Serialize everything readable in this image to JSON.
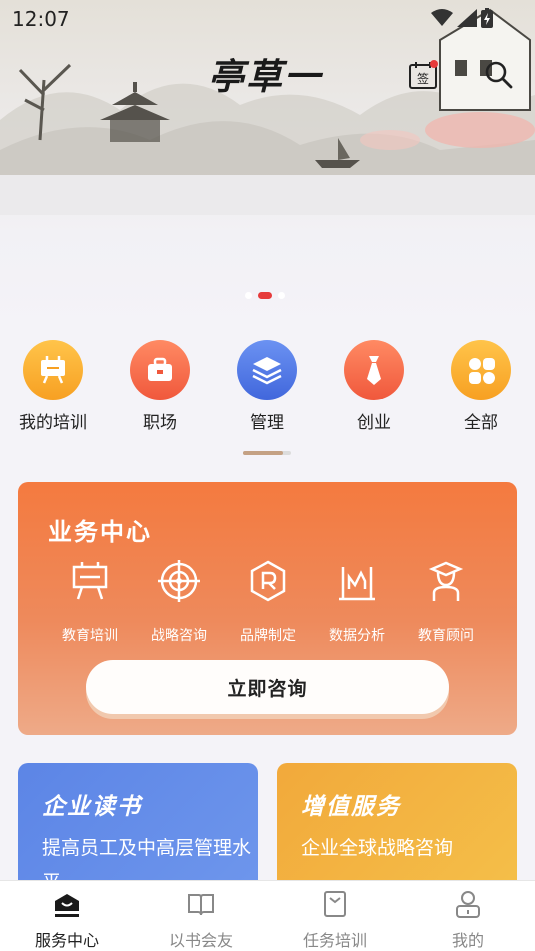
{
  "status": {
    "time": "12:07"
  },
  "header": {
    "logo": "亭草一",
    "sign_label": "签"
  },
  "categories": [
    {
      "label": "我的培训",
      "icon": "training-board-icon",
      "color": "#f7a823"
    },
    {
      "label": "职场",
      "icon": "briefcase-icon",
      "color": "#f26a4a"
    },
    {
      "label": "管理",
      "icon": "layers-icon",
      "color": "#4f79e8"
    },
    {
      "label": "创业",
      "icon": "tie-icon",
      "color": "#f26a4a"
    },
    {
      "label": "全部",
      "icon": "grid-icon",
      "color": "#f7a823"
    }
  ],
  "business": {
    "title": "业务中心",
    "items": [
      {
        "label": "教育培训",
        "icon": "easel-icon"
      },
      {
        "label": "战略咨询",
        "icon": "target-icon"
      },
      {
        "label": "品牌制定",
        "icon": "registered-icon"
      },
      {
        "label": "数据分析",
        "icon": "chart-icon"
      },
      {
        "label": "教育顾问",
        "icon": "graduate-icon"
      }
    ],
    "consult_button": "立即咨询"
  },
  "cards": [
    {
      "title": "企业读书",
      "subtitle": "提高员工及中高层管理水平"
    },
    {
      "title": "增值服务",
      "subtitle": "企业全球战略咨询"
    }
  ],
  "nav": [
    {
      "label": "服务中心",
      "icon": "service-center-icon",
      "active": true
    },
    {
      "label": "以书会友",
      "icon": "book-icon",
      "active": false
    },
    {
      "label": "任务培训",
      "icon": "task-icon",
      "active": false
    },
    {
      "label": "我的",
      "icon": "profile-icon",
      "active": false
    }
  ],
  "colors": {
    "accent": "#f47a3f",
    "dot_active": "#e63b3b"
  }
}
